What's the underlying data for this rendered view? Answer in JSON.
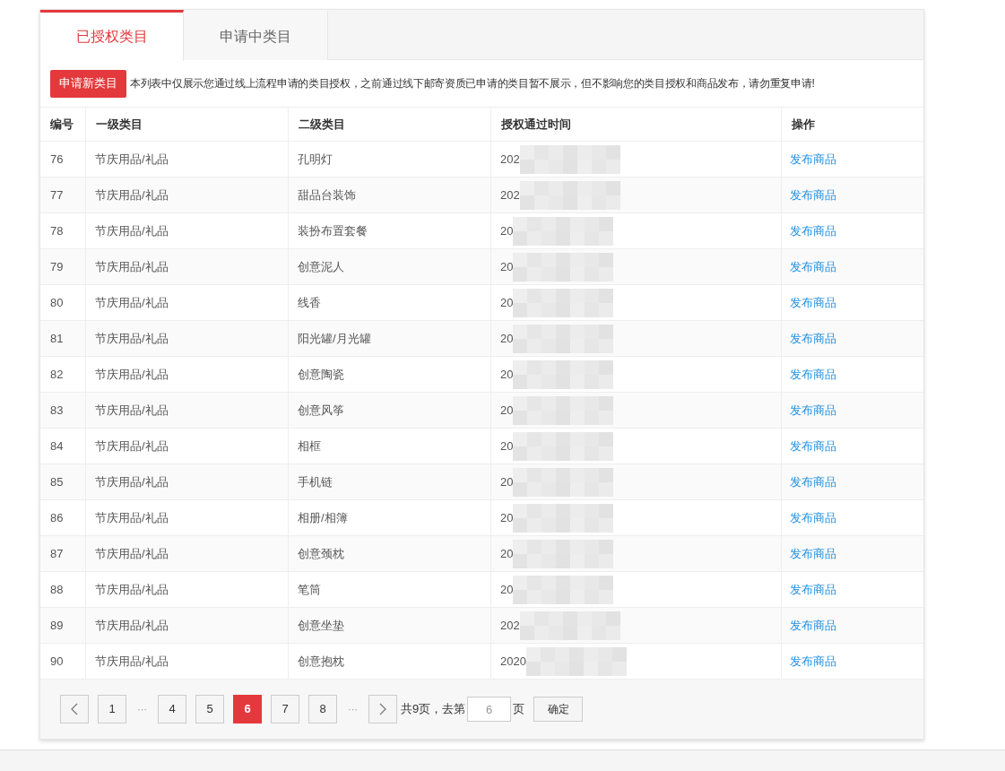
{
  "tabs": [
    {
      "label": "已授权类目",
      "selected": true
    },
    {
      "label": "申请中类目",
      "selected": false
    }
  ],
  "notice": {
    "button": "申请新类目",
    "text": "本列表中仅展示您通过线上流程申请的类目授权，之前通过线下邮寄资质已申请的类目暂不展示，但不影响您的类目授权和商品发布，请勿重复申请!"
  },
  "table": {
    "columns": [
      "编号",
      "一级类目",
      "二级类目",
      "授权通过时间",
      "操作"
    ],
    "rows": [
      {
        "id": "76",
        "level1": "节庆用品/礼品",
        "level2": "孔明灯",
        "time": "202",
        "action": "发布商品"
      },
      {
        "id": "77",
        "level1": "节庆用品/礼品",
        "level2": "甜品台装饰",
        "time": "202",
        "action": "发布商品"
      },
      {
        "id": "78",
        "level1": "节庆用品/礼品",
        "level2": "装扮布置套餐",
        "time": "20",
        "action": "发布商品"
      },
      {
        "id": "79",
        "level1": "节庆用品/礼品",
        "level2": "创意泥人",
        "time": "20",
        "action": "发布商品"
      },
      {
        "id": "80",
        "level1": "节庆用品/礼品",
        "level2": "线香",
        "time": "20",
        "action": "发布商品"
      },
      {
        "id": "81",
        "level1": "节庆用品/礼品",
        "level2": "阳光罐/月光罐",
        "time": "20",
        "action": "发布商品"
      },
      {
        "id": "82",
        "level1": "节庆用品/礼品",
        "level2": "创意陶瓷",
        "time": "20",
        "action": "发布商品"
      },
      {
        "id": "83",
        "level1": "节庆用品/礼品",
        "level2": "创意风筝",
        "time": "20",
        "action": "发布商品"
      },
      {
        "id": "84",
        "level1": "节庆用品/礼品",
        "level2": "相框",
        "time": "20",
        "action": "发布商品"
      },
      {
        "id": "85",
        "level1": "节庆用品/礼品",
        "level2": "手机链",
        "time": "20",
        "action": "发布商品"
      },
      {
        "id": "86",
        "level1": "节庆用品/礼品",
        "level2": "相册/相簿",
        "time": "20",
        "action": "发布商品"
      },
      {
        "id": "87",
        "level1": "节庆用品/礼品",
        "level2": "创意颈枕",
        "time": "20",
        "action": "发布商品"
      },
      {
        "id": "88",
        "level1": "节庆用品/礼品",
        "level2": "笔筒",
        "time": "20",
        "action": "发布商品"
      },
      {
        "id": "89",
        "level1": "节庆用品/礼品",
        "level2": "创意坐垫",
        "time": "202",
        "action": "发布商品"
      },
      {
        "id": "90",
        "level1": "节庆用品/礼品",
        "level2": "创意抱枕",
        "time": "2020",
        "action": "发布商品"
      }
    ]
  },
  "pagination": {
    "items": [
      {
        "kind": "prev"
      },
      {
        "kind": "page",
        "label": "1",
        "selected": false
      },
      {
        "kind": "ellipsis",
        "label": "···"
      },
      {
        "kind": "page",
        "label": "4",
        "selected": false
      },
      {
        "kind": "page",
        "label": "5",
        "selected": false
      },
      {
        "kind": "page",
        "label": "6",
        "selected": true
      },
      {
        "kind": "page",
        "label": "7",
        "selected": false
      },
      {
        "kind": "page",
        "label": "8",
        "selected": false
      },
      {
        "kind": "ellipsis",
        "label": "···"
      },
      {
        "kind": "next"
      }
    ],
    "total": "共9页，去第",
    "goto_value": "6",
    "page_suffix": "页",
    "confirm": "确定"
  }
}
